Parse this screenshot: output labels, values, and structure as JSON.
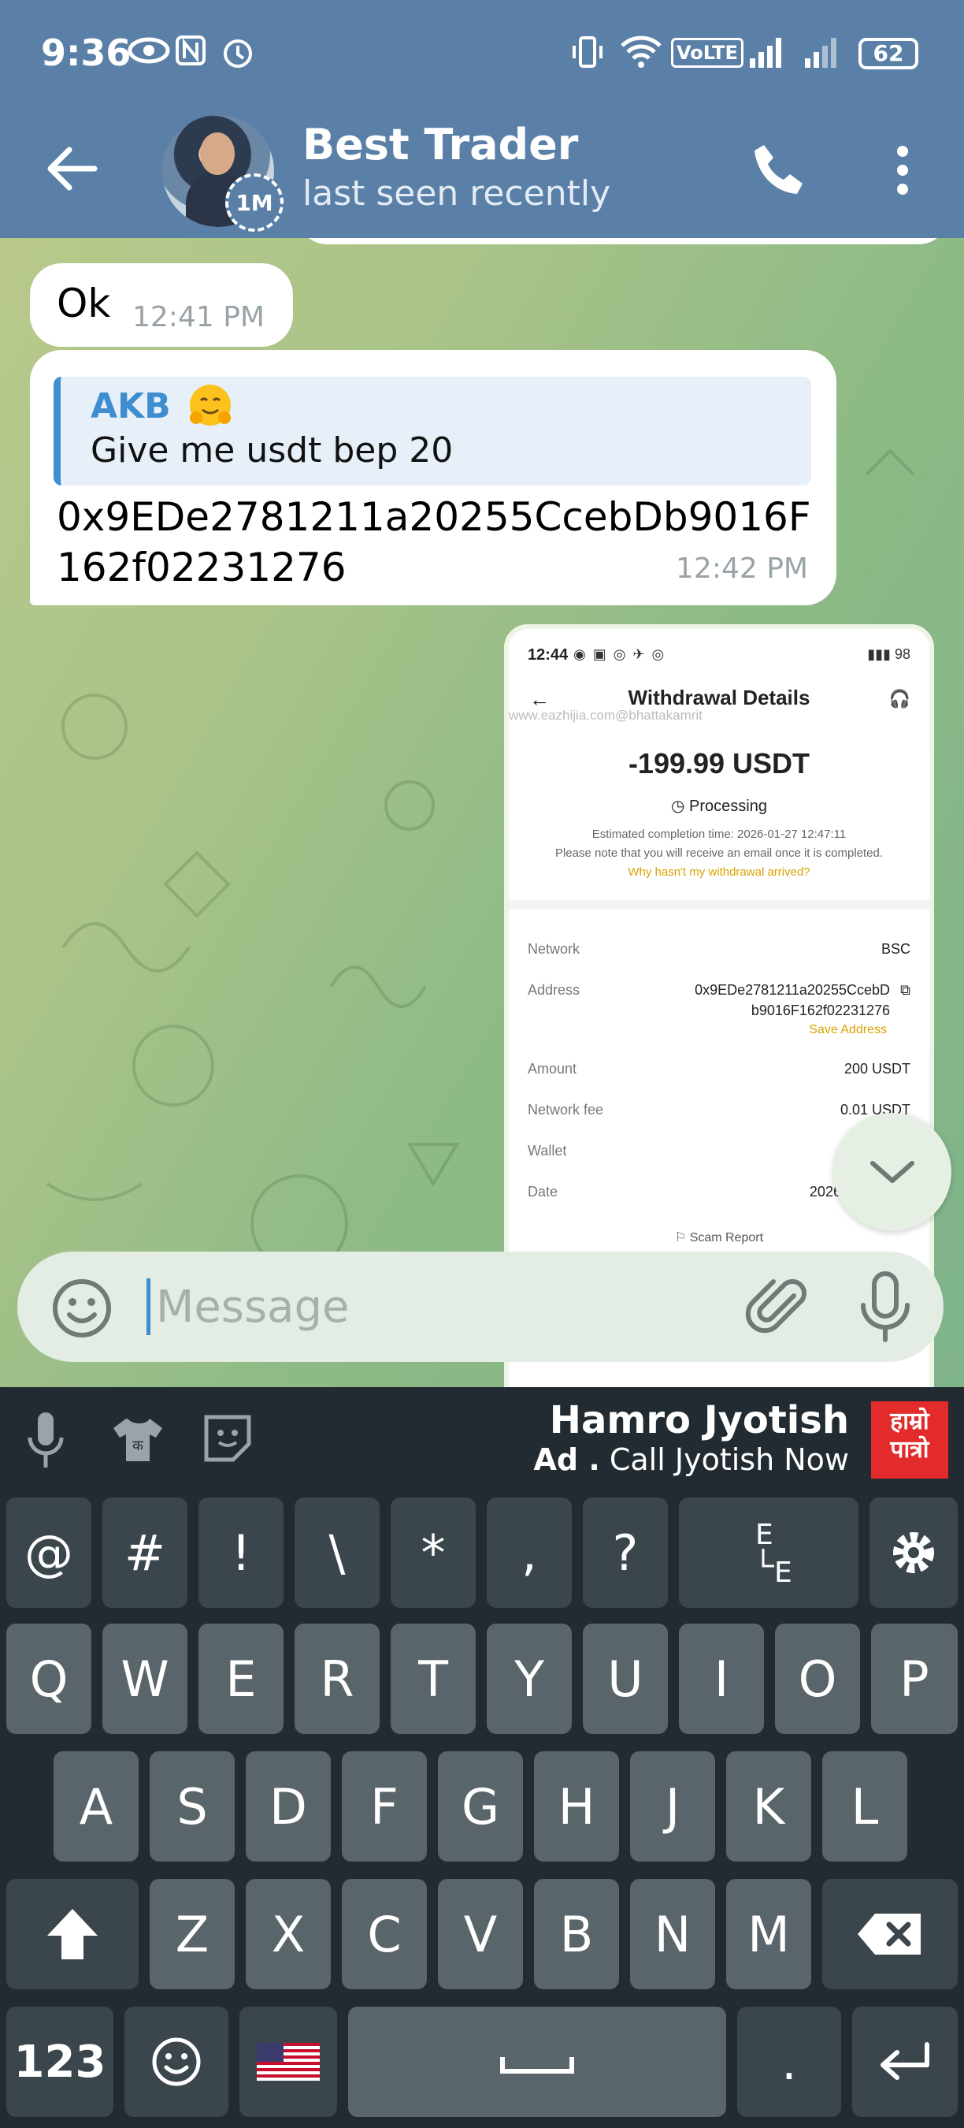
{
  "status_bar": {
    "time": "9:36",
    "battery": "62",
    "icons": [
      "eye-icon",
      "nfc-icon",
      "alarm-icon",
      "vibrate-icon",
      "wifi-icon",
      "volte-icon",
      "signal-icon",
      "signal-r-icon",
      "battery-icon"
    ],
    "volte_label": "VoLTE"
  },
  "header": {
    "chat_name": "Best Trader",
    "chat_status": "last seen recently",
    "timer_badge": "1M"
  },
  "messages": {
    "ok": {
      "text": "Ok",
      "time": "12:41 PM"
    },
    "reply": {
      "quote_author": "AKB",
      "quote_emoji": "hugging-face-emoji",
      "quote_text": "Give me usdt bep 20",
      "body": "0x9EDe2781211a20255CcebDb9016F162f02231276",
      "time": "12:42 PM"
    }
  },
  "screenshot_card": {
    "time": "12:44",
    "battery": "98",
    "title": "Withdrawal Details",
    "watermark": "www.eazhijia.com@bhattakamrit",
    "amount": "-199.99 USDT",
    "state": "Processing",
    "estimate": "Estimated completion time: 2026-01-27 12:47:11",
    "note": "Please note that you will receive an email once it is completed.",
    "help_link": "Why hasn't my withdrawal arrived?",
    "rows": {
      "network": {
        "label": "Network",
        "value": "BSC"
      },
      "address": {
        "label": "Address",
        "value_line1": "0x9EDe2781211a20255CcebD",
        "value_line2": "b9016F162f02231276"
      },
      "save_address": "Save Address",
      "amount": {
        "label": "Amount",
        "value": "200 USDT"
      },
      "fee": {
        "label": "Network fee",
        "value": "0.01 USDT"
      },
      "wallet": {
        "label": "Wallet",
        "value": ""
      },
      "date": {
        "label": "Date",
        "value": "2026-01-2"
      }
    },
    "scam_report": "Scam Report"
  },
  "composer": {
    "placeholder": "Message"
  },
  "keyboard": {
    "ad_title": "Hamro Jyotish",
    "ad_prefix": "Ad .",
    "ad_text": "Call Jyotish Now",
    "ad_logo_line1": "हाम्रो",
    "ad_logo_line2": "पात्रो",
    "row_symbols": [
      "@",
      "#",
      "!",
      "\\",
      "*",
      ",",
      "?"
    ],
    "row1": [
      "Q",
      "W",
      "E",
      "R",
      "T",
      "Y",
      "U",
      "I",
      "O",
      "P"
    ],
    "row2": [
      "A",
      "S",
      "D",
      "F",
      "G",
      "H",
      "J",
      "K",
      "L"
    ],
    "row3": [
      "Z",
      "X",
      "C",
      "V",
      "B",
      "N",
      "M"
    ],
    "numbers_label": "123",
    "period_label": ".",
    "language_flag": "us-flag-icon"
  },
  "colors": {
    "header": "#5a80a7",
    "accent": "#3d8dcf",
    "keyboard_bg": "#222b32",
    "key": "#5a646b"
  }
}
